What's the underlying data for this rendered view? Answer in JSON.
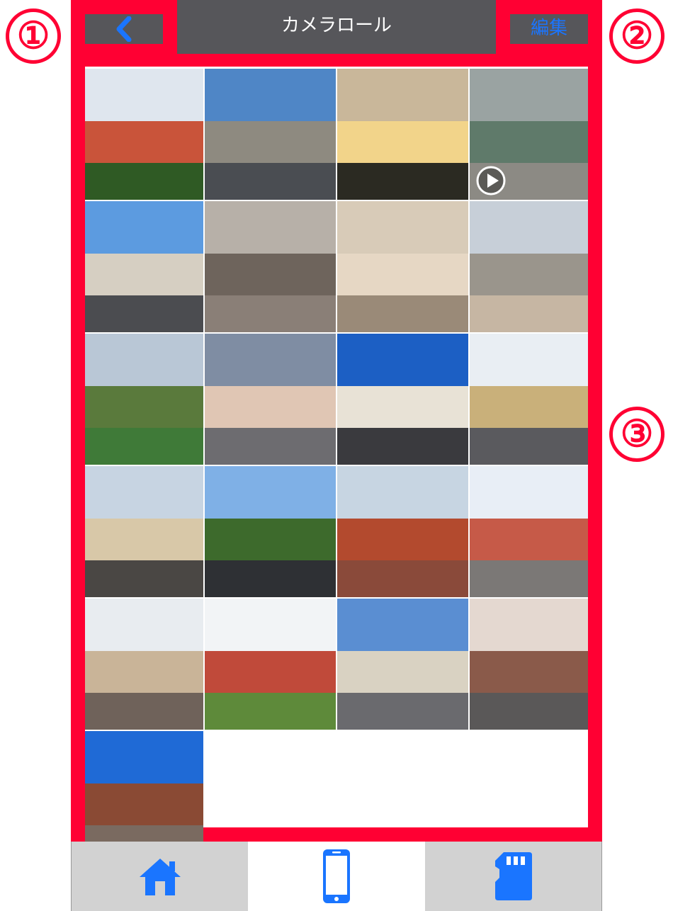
{
  "callouts": [
    "①",
    "②",
    "③"
  ],
  "header": {
    "title": "カメラロール",
    "edit_label": "編集",
    "back_icon": "chevron-left-icon"
  },
  "colors": {
    "highlight": "#ff0033",
    "navbar": "#56565a",
    "accent": "#1a75ff",
    "tabbar": "#d2d2d2"
  },
  "photos": [
    {
      "sky": "#dfe6ee",
      "mid": "#c9543a",
      "ground": "#2f5a24",
      "video": false
    },
    {
      "sky": "#4f86c6",
      "mid": "#8e8a80",
      "ground": "#4a4d52",
      "video": false
    },
    {
      "sky": "#c9b79a",
      "mid": "#f2d48a",
      "ground": "#2b2a22",
      "video": false
    },
    {
      "sky": "#9aa3a2",
      "mid": "#5f7a6a",
      "ground": "#8c8a84",
      "video": true
    },
    {
      "sky": "#5c9be0",
      "mid": "#d6cfc2",
      "ground": "#4b4c50",
      "video": false
    },
    {
      "sky": "#b7b0a8",
      "mid": "#6e645c",
      "ground": "#8a7f77",
      "video": false
    },
    {
      "sky": "#d8cbb8",
      "mid": "#e6d7c4",
      "ground": "#9a8a78",
      "video": false
    },
    {
      "sky": "#c7cfd8",
      "mid": "#9a958c",
      "ground": "#c6b6a3",
      "video": false
    },
    {
      "sky": "#b9c7d6",
      "mid": "#5a7a3c",
      "ground": "#3f7a38",
      "video": false
    },
    {
      "sky": "#7f8da3",
      "mid": "#e0c6b4",
      "ground": "#6d6c70",
      "video": false
    },
    {
      "sky": "#1c5fc4",
      "mid": "#e8e2d6",
      "ground": "#3a3a3e",
      "video": false
    },
    {
      "sky": "#e9eef3",
      "mid": "#c9b07a",
      "ground": "#5a5a5e",
      "video": false
    },
    {
      "sky": "#c7d4e2",
      "mid": "#d8c8a8",
      "ground": "#4a4744",
      "video": false
    },
    {
      "sky": "#7fb0e6",
      "mid": "#3d6a2c",
      "ground": "#2e3034",
      "video": false
    },
    {
      "sky": "#c7d5e2",
      "mid": "#b34a2e",
      "ground": "#8a4a3a",
      "video": false
    },
    {
      "sky": "#e8eef6",
      "mid": "#c65a48",
      "ground": "#7b7876",
      "video": false
    },
    {
      "sky": "#e8ecf0",
      "mid": "#c9b498",
      "ground": "#6f625a",
      "video": false
    },
    {
      "sky": "#f2f4f6",
      "mid": "#c04a3a",
      "ground": "#5e8a3a",
      "video": false
    },
    {
      "sky": "#5a8ed2",
      "mid": "#d9d2c2",
      "ground": "#6a6a6e",
      "video": false
    },
    {
      "sky": "#e4d8d0",
      "mid": "#8a5a4a",
      "ground": "#5a5858",
      "video": false
    },
    {
      "sky": "#1f6ad6",
      "mid": "#8a4a34",
      "ground": "#7a6a60",
      "video": false
    }
  ],
  "tabbar": {
    "tabs": [
      {
        "icon": "home-icon",
        "selected": false
      },
      {
        "icon": "smartphone-icon",
        "selected": true
      },
      {
        "icon": "sd-card-icon",
        "selected": false
      }
    ]
  }
}
